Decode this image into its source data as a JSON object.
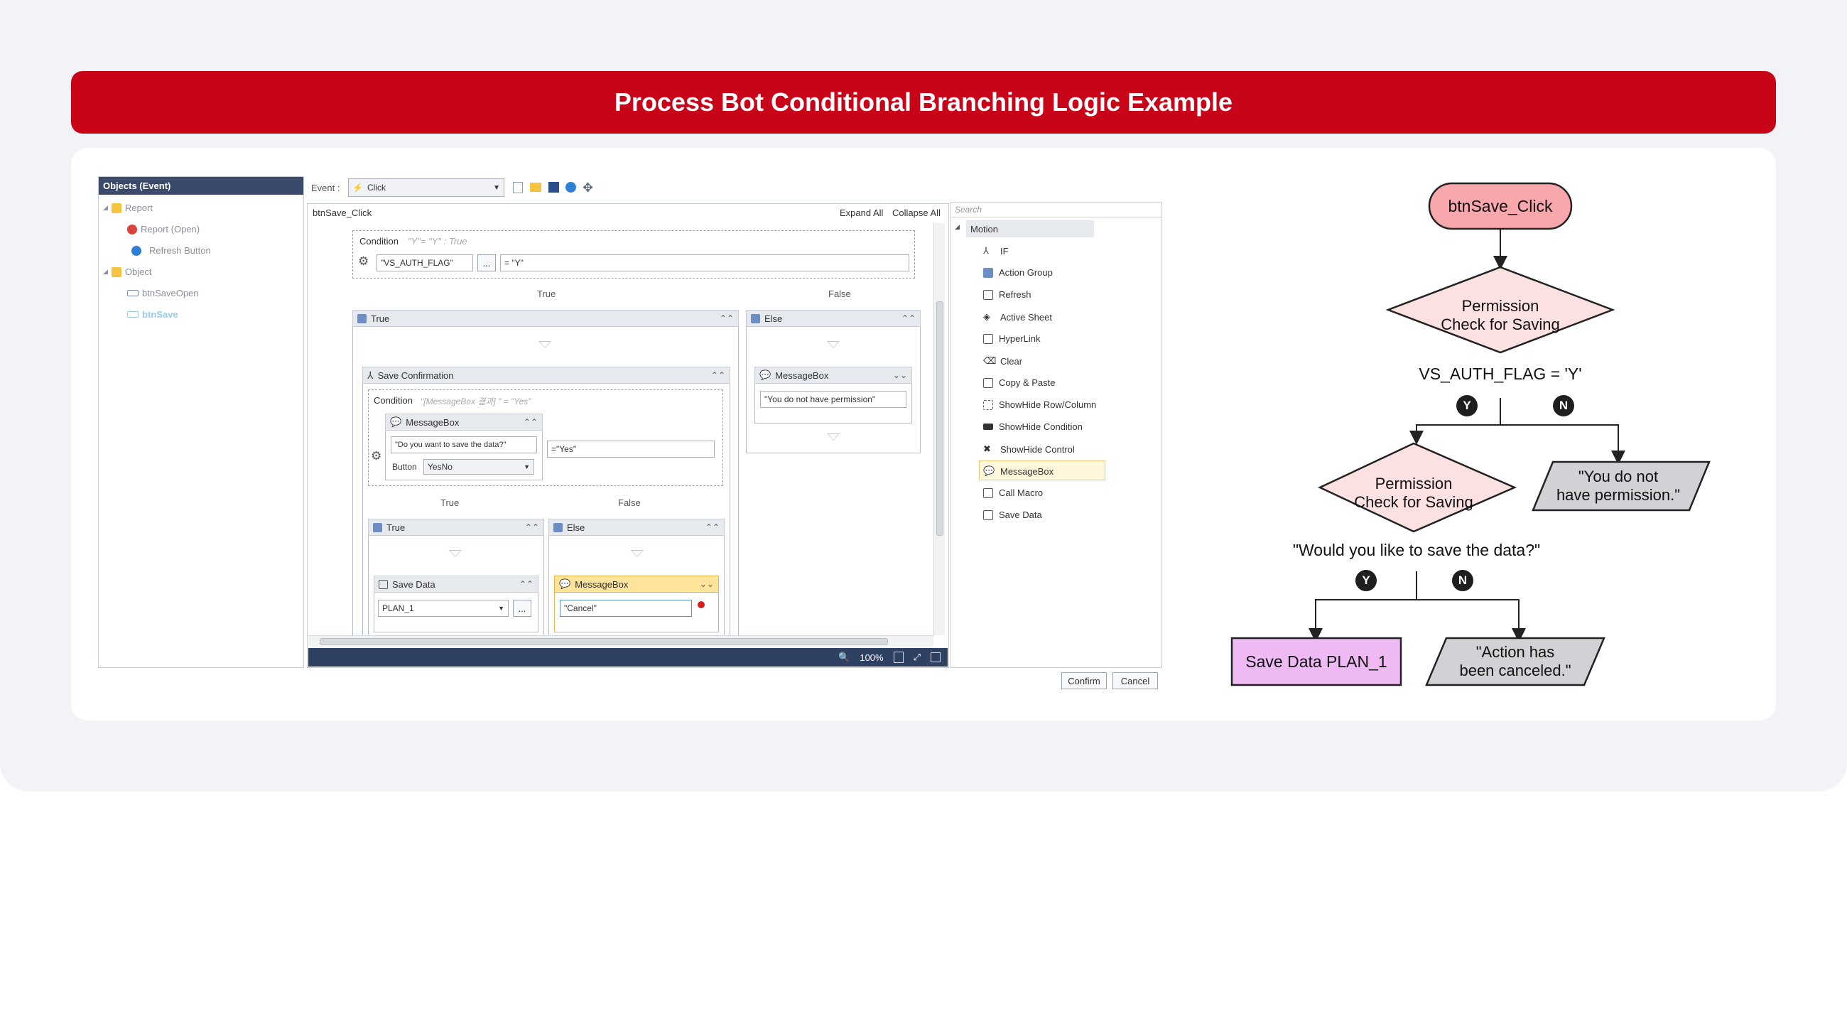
{
  "banner": {
    "title": "Process Bot Conditional Branching Logic Example"
  },
  "objects_panel": {
    "header": "Objects (Event)",
    "items": [
      {
        "label": "Report"
      },
      {
        "label": "Report (Open)"
      },
      {
        "label": "Refresh Button"
      },
      {
        "label": "Object"
      },
      {
        "label": "btnSaveOpen"
      },
      {
        "label": "btnSave"
      }
    ]
  },
  "toolbar": {
    "event_label": "Event :",
    "event_value": "Click"
  },
  "editor": {
    "title": "btnSave_Click",
    "expand_all": "Expand All",
    "collapse_all": "Collapse All",
    "condition_top": {
      "label": "Condition",
      "hint": "\"Y\"= \"Y\" : True",
      "field": "\"VS_AUTH_FLAG\"",
      "browse": "...",
      "value": "= \"Y\""
    },
    "true_label": "True",
    "false_label": "False",
    "true_block": "True",
    "else_block": "Else",
    "save_confirmation": {
      "title": "Save Confirmation",
      "cond_label": "Condition",
      "cond_hint": "\"[MessageBox 결과] \" = \"Yes\"",
      "msgbox_title": "MessageBox",
      "msgbox_text": "\"Do you want to save the data?\"",
      "button_label": "Button",
      "button_value": "YesNo",
      "compare_value": "=\"Yes\""
    },
    "else_msgbox": {
      "title": "MessageBox",
      "text": "\"You do not have permission\""
    },
    "inner_true_label": "True",
    "inner_false_label": "False",
    "inner_true_block": "True",
    "inner_else_block": "Else",
    "save_data": {
      "title": "Save Data",
      "value": "PLAN_1",
      "browse": "..."
    },
    "cancel_msgbox": {
      "title": "MessageBox",
      "text": "\"Cancel\""
    },
    "zoom": "100%"
  },
  "motion_panel": {
    "search_placeholder": "Search",
    "header": "Motion",
    "items": [
      {
        "label": "IF",
        "icon": "if-icon"
      },
      {
        "label": "Action Group",
        "icon": "action-group-icon"
      },
      {
        "label": "Refresh",
        "icon": "refresh-icon"
      },
      {
        "label": "Active Sheet",
        "icon": "active-sheet-icon"
      },
      {
        "label": "HyperLink",
        "icon": "hyperlink-icon"
      },
      {
        "label": "Clear",
        "icon": "clear-icon"
      },
      {
        "label": "Copy & Paste",
        "icon": "copy-paste-icon"
      },
      {
        "label": "ShowHide Row/Column",
        "icon": "showhide-row-icon"
      },
      {
        "label": "ShowHide Condition",
        "icon": "showhide-condition-icon"
      },
      {
        "label": "ShowHide Control",
        "icon": "showhide-control-icon"
      },
      {
        "label": "MessageBox",
        "icon": "messagebox-icon"
      },
      {
        "label": "Call Macro",
        "icon": "call-macro-icon"
      },
      {
        "label": "Save Data",
        "icon": "save-data-icon"
      }
    ],
    "selected": "MessageBox"
  },
  "footer": {
    "confirm": "Confirm",
    "cancel": "Cancel"
  },
  "flowchart": {
    "start": "btnSave_Click",
    "decision1": "Permission\nCheck for Saving",
    "condition1": "VS_AUTH_FLAG = 'Y'",
    "yes": "Y",
    "no": "N",
    "decision2": "Permission\nCheck for Saving",
    "no_permission": "\"You do not\nhave permission.\"",
    "question": "\"Would you like to save the data?\"",
    "save": "Save Data PLAN_1",
    "canceled": "\"Action has\nbeen canceled.\"",
    "colors": {
      "start": "#f8a8ad",
      "decision": "#fce1e3",
      "save": "#efb9f4",
      "output": "#d0d2d6"
    }
  }
}
